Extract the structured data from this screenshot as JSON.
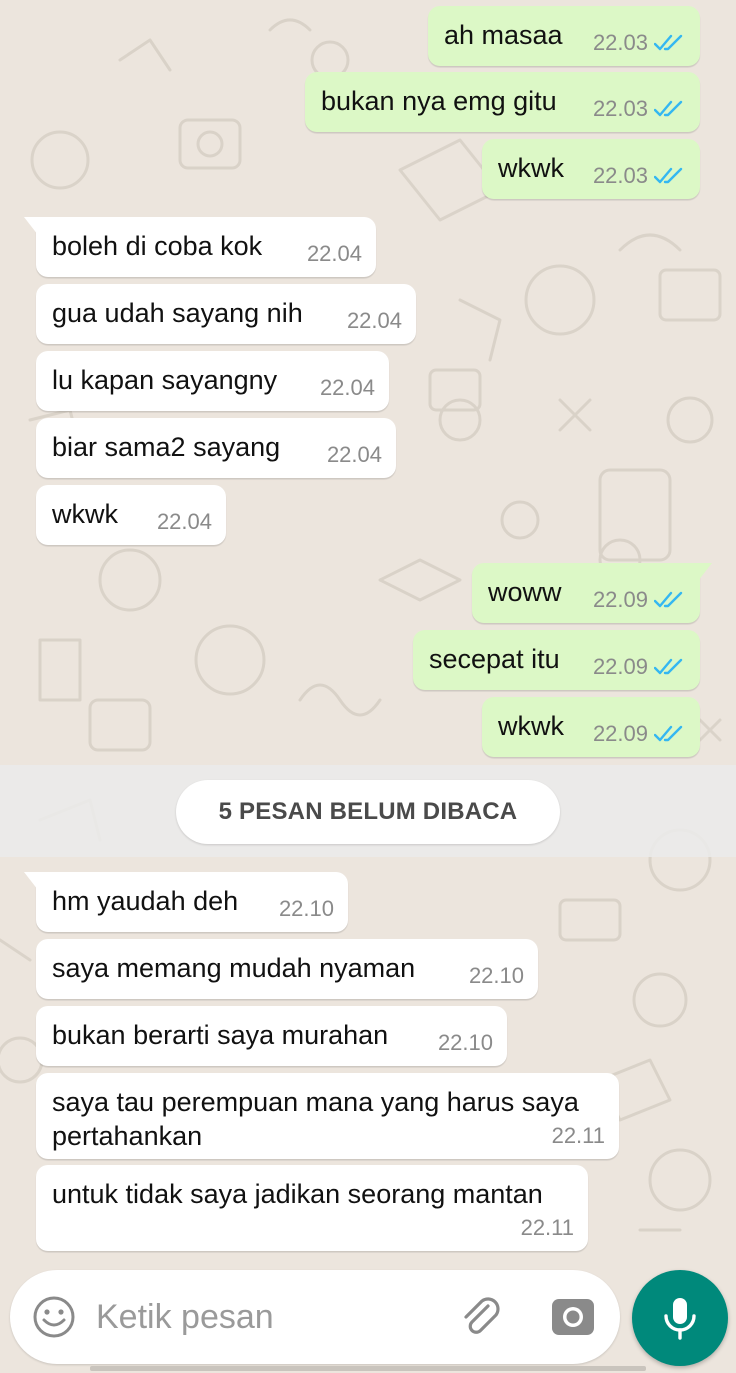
{
  "colors": {
    "outgoing_bubble": "#dcf8c6",
    "incoming_bubble": "#ffffff",
    "read_ticks": "#34b7f1",
    "mic_button": "#00897b"
  },
  "messages": [
    {
      "direction": "out",
      "text": "ah masaa",
      "time": "22.03",
      "status": "read"
    },
    {
      "direction": "out",
      "text": "bukan nya emg gitu",
      "time": "22.03",
      "status": "read"
    },
    {
      "direction": "out",
      "text": "wkwk",
      "time": "22.03",
      "status": "read"
    },
    {
      "direction": "in",
      "text": "boleh di coba kok",
      "time": "22.04"
    },
    {
      "direction": "in",
      "text": "gua udah sayang nih",
      "time": "22.04"
    },
    {
      "direction": "in",
      "text": "lu kapan sayangny",
      "time": "22.04"
    },
    {
      "direction": "in",
      "text": "biar sama2 sayang",
      "time": "22.04"
    },
    {
      "direction": "in",
      "text": "wkwk",
      "time": "22.04"
    },
    {
      "direction": "out",
      "text": "woww",
      "time": "22.09",
      "status": "read"
    },
    {
      "direction": "out",
      "text": "secepat itu",
      "time": "22.09",
      "status": "read"
    },
    {
      "direction": "out",
      "text": "wkwk",
      "time": "22.09",
      "status": "read"
    },
    {
      "direction": "in",
      "text": "hm yaudah deh",
      "time": "22.10"
    },
    {
      "direction": "in",
      "text": "saya memang mudah nyaman",
      "time": "22.10"
    },
    {
      "direction": "in",
      "text": "bukan berarti saya murahan",
      "time": "22.10"
    },
    {
      "direction": "in",
      "text": "saya tau perempuan mana yang harus saya pertahankan",
      "time": "22.11"
    },
    {
      "direction": "in",
      "text": "untuk tidak saya jadikan seorang mantan",
      "time": "22.11"
    }
  ],
  "unread_banner": "5 PESAN BELUM DIBACA",
  "input": {
    "placeholder": "Ketik pesan",
    "value": ""
  },
  "icons": {
    "emoji": "emoji-icon",
    "attach": "paperclip-icon",
    "camera": "camera-icon",
    "mic": "microphone-icon",
    "read_status": "double-check-icon"
  }
}
